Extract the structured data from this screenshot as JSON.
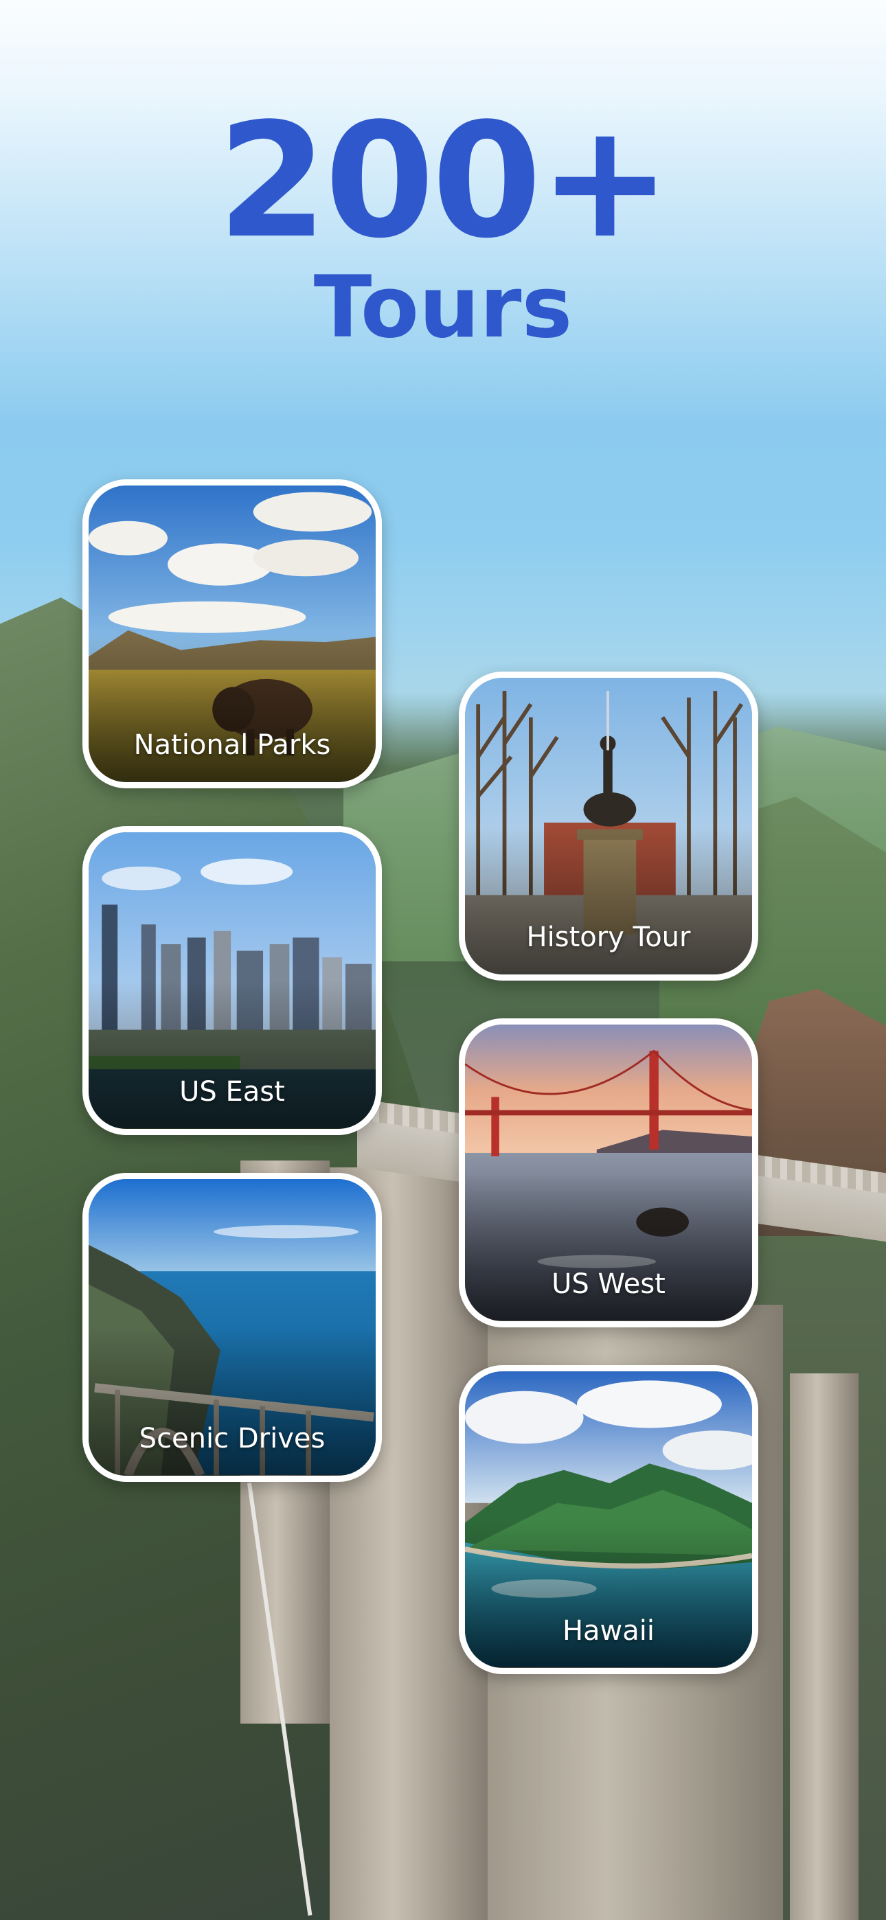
{
  "headline": {
    "count": "200+",
    "label": "Tours"
  },
  "categories": [
    {
      "label": "National Parks",
      "icon": "bison-photo"
    },
    {
      "label": "History Tour",
      "icon": "statue-photo"
    },
    {
      "label": "US East",
      "icon": "city-skyline-photo"
    },
    {
      "label": "US West",
      "icon": "golden-gate-photo"
    },
    {
      "label": "Scenic Drives",
      "icon": "coastal-bridge-photo"
    },
    {
      "label": "Hawaii",
      "icon": "island-photo"
    }
  ],
  "colors": {
    "headline": "#2e58cc",
    "card_border": "#ffffff",
    "sky": "#8ccbef"
  }
}
